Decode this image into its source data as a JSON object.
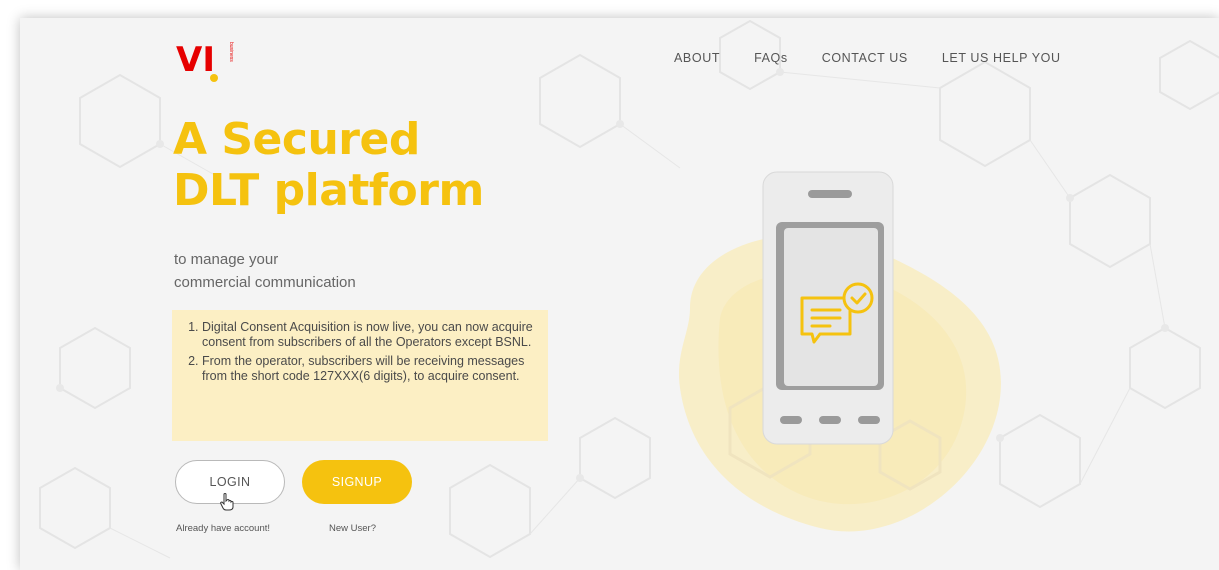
{
  "brand": {
    "logo_text": "VI",
    "logo_sub": "business",
    "accent": "#f5c20f",
    "red": "#e60000"
  },
  "nav": {
    "about": "ABOUT",
    "faqs": "FAQs",
    "contact": "CONTACT US",
    "help": "LET US HELP YOU"
  },
  "hero": {
    "title_line1": "A Secured",
    "title_line2": "DLT platform",
    "sub_line1": "to manage your",
    "sub_line2": "commercial communication"
  },
  "notice": {
    "items": [
      "Digital Consent Acquisition is now live, you can now acquire consent from subscribers of all the Operators except BSNL.",
      "From the operator, subscribers will be receiving messages from the short code 127XXX(6 digits), to acquire consent."
    ],
    "background": "#fcefc4"
  },
  "actions": {
    "login_label": "LOGIN",
    "signup_label": "SIGNUP",
    "login_caption": "Already have account!",
    "signup_caption": "New User?"
  },
  "illustration": {
    "icon": "phone-chat-check-icon"
  }
}
